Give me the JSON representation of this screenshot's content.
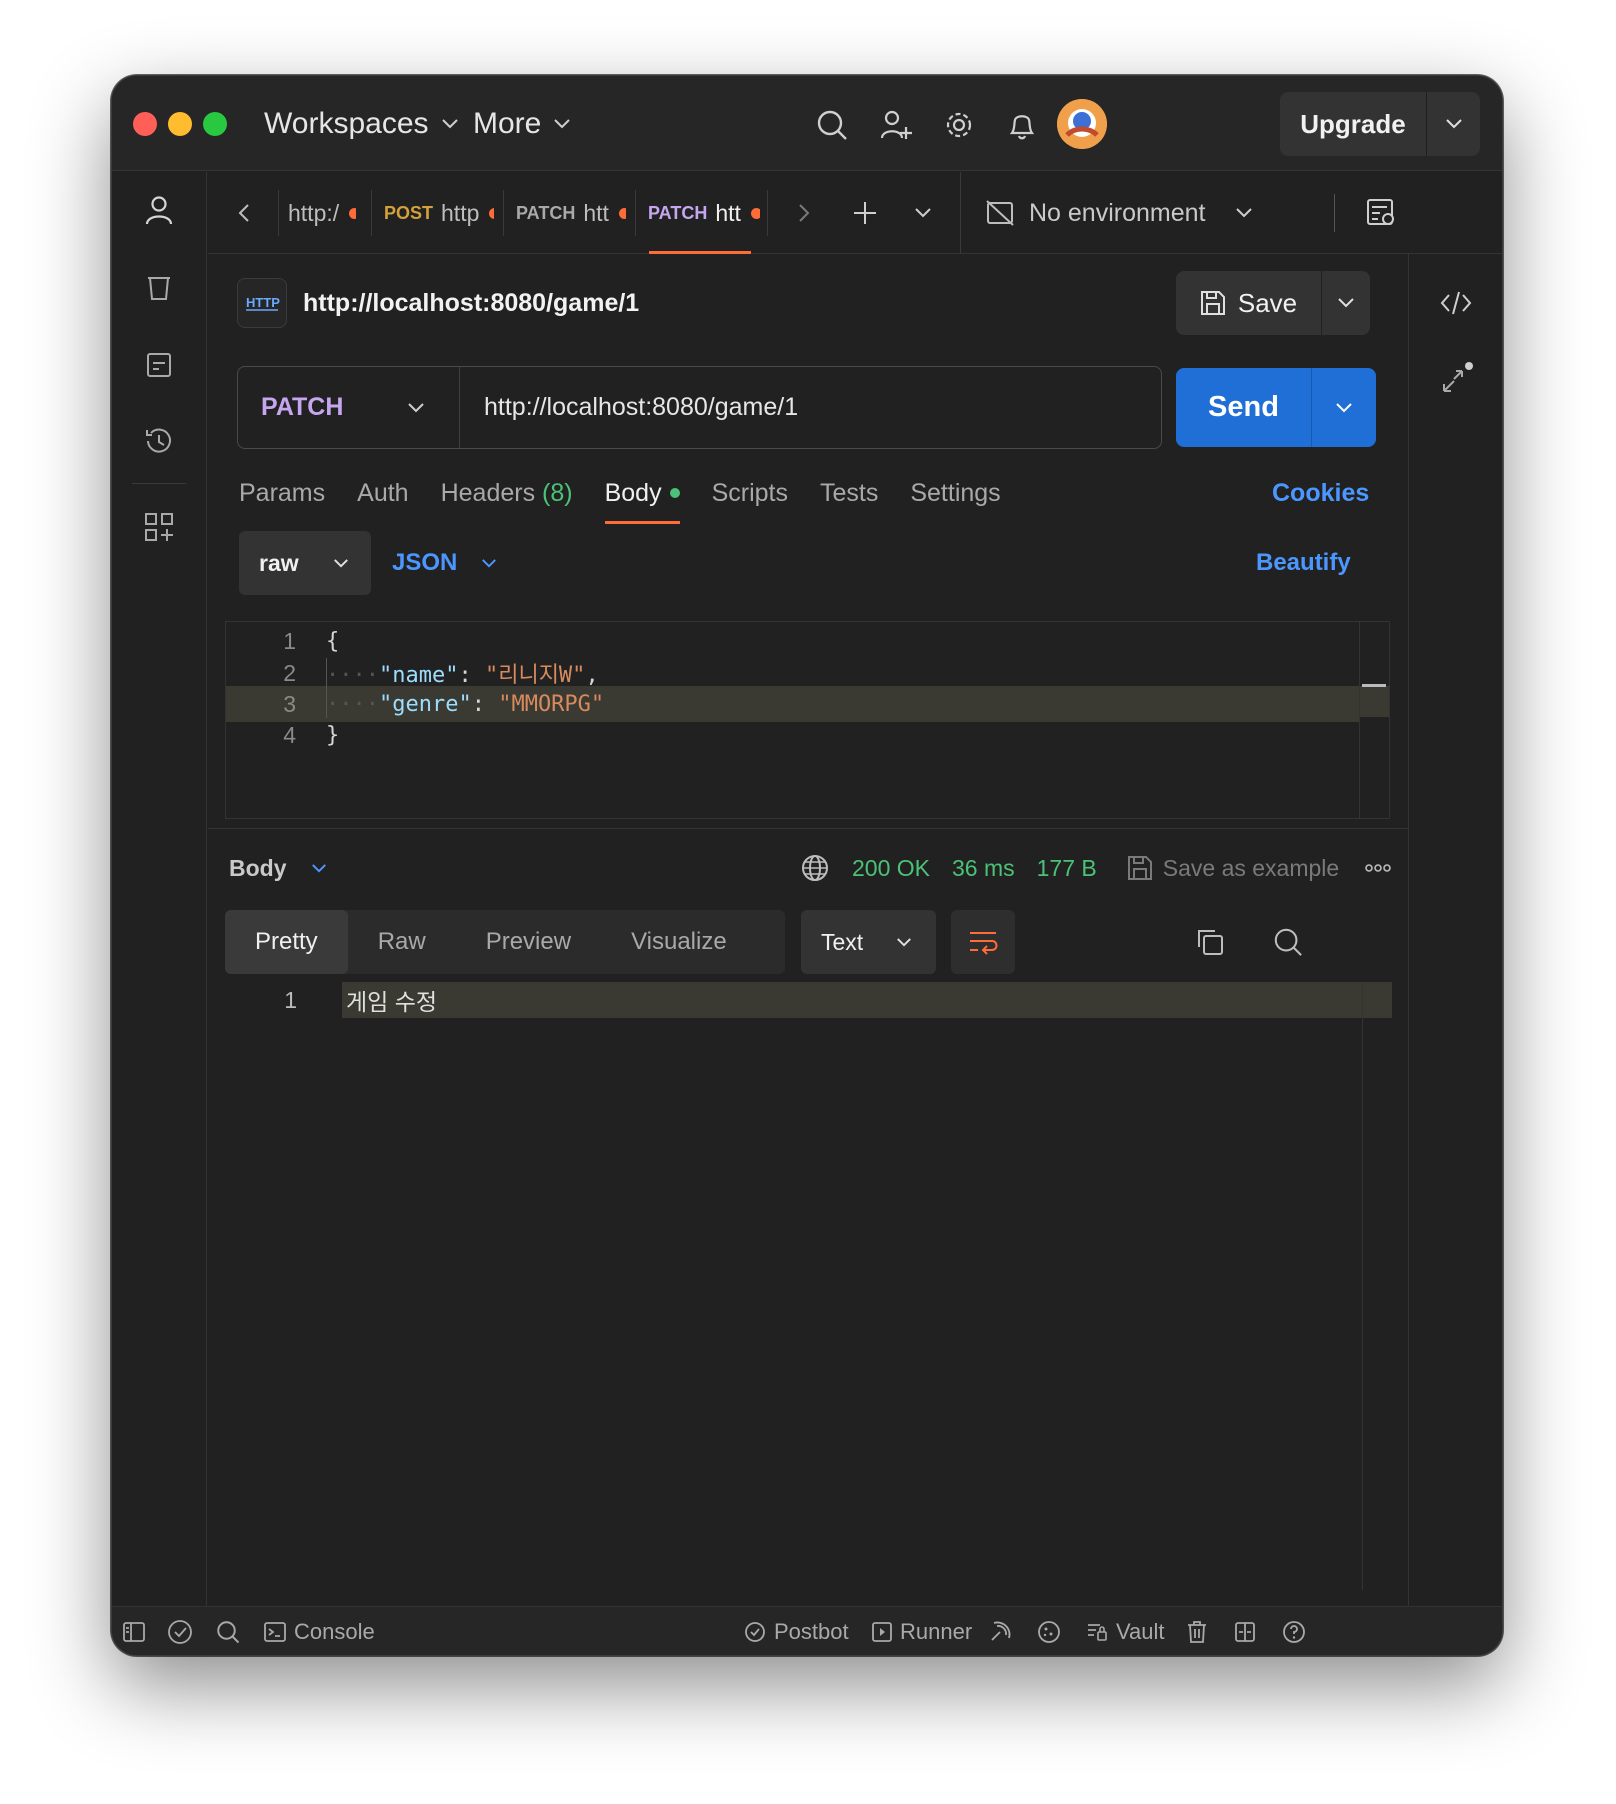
{
  "titlebar": {
    "workspaces_label": "Workspaces",
    "more_label": "More",
    "upgrade_label": "Upgrade"
  },
  "tabs": [
    {
      "method": "",
      "text": "http:/",
      "method_color": ""
    },
    {
      "method": "POST",
      "text": "http",
      "method_color": "#d4a13a"
    },
    {
      "method": "PATCH",
      "text": "htt",
      "method_color": "#c7a6f0"
    },
    {
      "method": "PATCH",
      "text": "htt",
      "method_color": "#c7a6f0"
    }
  ],
  "environment": {
    "label": "No environment"
  },
  "request": {
    "title": "http://localhost:8080/game/1",
    "save_label": "Save",
    "method": "PATCH",
    "url": "http://localhost:8080/game/1",
    "send_label": "Send",
    "tabs": {
      "params": "Params",
      "auth": "Auth",
      "headers": "Headers",
      "headers_count": "(8)",
      "body": "Body",
      "scripts": "Scripts",
      "tests": "Tests",
      "settings": "Settings"
    },
    "cookies_label": "Cookies",
    "body_mode": "raw",
    "body_language": "JSON",
    "beautify_label": "Beautify",
    "body_lines": {
      "l1": {
        "num": "1",
        "open": "{"
      },
      "l2": {
        "num": "2",
        "key": "\"name\"",
        "colon": ": ",
        "value": "\"리니지W\"",
        "comma": ","
      },
      "l3": {
        "num": "3",
        "key": "\"genre\"",
        "colon": ": ",
        "value": "\"MMORPG\""
      },
      "l4": {
        "num": "4",
        "close": "}"
      }
    }
  },
  "response": {
    "section_label": "Body",
    "status": "200 OK",
    "time": "36 ms",
    "size": "177 B",
    "save_example_label": "Save as example",
    "view_tabs": {
      "pretty": "Pretty",
      "raw": "Raw",
      "preview": "Preview",
      "visualize": "Visualize"
    },
    "format": "Text",
    "line_num": "1",
    "line_text": "게임 수정"
  },
  "statusbar": {
    "console": "Console",
    "postbot": "Postbot",
    "runner": "Runner",
    "vault": "Vault"
  },
  "colors": {
    "accent_orange": "#ff6c37",
    "send_blue": "#1f6fd6",
    "link_blue": "#4b97ff",
    "status_green": "#4bc277"
  }
}
